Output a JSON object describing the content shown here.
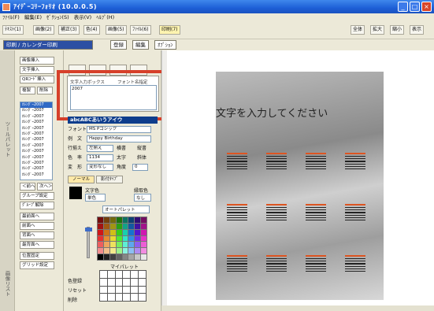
{
  "app": {
    "title": "ｱｲﾃﾞｰｺﾘｰﾌｫﾘｵ (10.0.0.5)"
  },
  "window_controls": [
    "_",
    "□",
    "×"
  ],
  "menu": [
    "ﾌｧｲﾙ(F)",
    "編集(E)",
    "ｾﾞｸｼｮﾝ(S)",
    "表示(V)",
    "ﾍﾙﾌﾟ(H)"
  ],
  "toolbar": {
    "buttons": [
      "ﾃｷｽﾄ(1)",
      "画像(2)",
      "補正(3)",
      "色(4)",
      "画像(5)",
      "ﾌｧｲﾙ(6)",
      "印刷(7)"
    ],
    "right_buttons": [
      "全体",
      "拡大",
      "縮小",
      "表示"
    ]
  },
  "tabs": {
    "breadcrumb": "印刷 / カレンダー印刷",
    "tab1": "登録",
    "tab2": "編集",
    "tab3": "ｵﾌﾟｼｮﾝ"
  },
  "side_label": "ツールパレット",
  "side_label2": "画像リスト",
  "left_buttons": {
    "image_insert": "画像挿入",
    "text_insert": "文字挿入",
    "qr_insert": "QRｺｰﾄﾞ挿入",
    "copy": "複製",
    "delete": "削除",
    "group_set": "グループ設定",
    "group_cancel": "ｸﾞﾙｰﾌﾟ解除",
    "front_most": "最前面へ",
    "front": "前面へ",
    "back": "背面へ",
    "back_most": "最背面へ",
    "lock": "位置固定",
    "grid": "グリッド設定",
    "prev": "＜前へ",
    "next": "次へ＞"
  },
  "list_items": [
    "ｶﾚﾝﾀﾞｰ2007",
    "ｶﾚﾝﾀﾞｰ2007",
    "ｶﾚﾝﾀﾞｰ2007",
    "ｶﾚﾝﾀﾞｰ2007",
    "ｶﾚﾝﾀﾞｰ2007",
    "ｶﾚﾝﾀﾞｰ2007",
    "ｶﾚﾝﾀﾞｰ2007",
    "ｶﾚﾝﾀﾞｰ2007",
    "ｶﾚﾝﾀﾞｰ2007",
    "ｶﾚﾝﾀﾞｰ2007",
    "ｶﾚﾝﾀﾞｰ2007",
    "ｶﾚﾝﾀﾞｰ2007",
    "ｶﾚﾝﾀﾞｰ2007"
  ],
  "text_box": {
    "label": "文字入力ボックス",
    "checkbox": "フォント名指定",
    "value": "2007"
  },
  "banner": "abcABCあいうアイウ",
  "props": {
    "font": {
      "key": "フォント",
      "value": "MS Pゴシック"
    },
    "sample": {
      "key": "例　文",
      "value": "Happy Birthday"
    },
    "align": {
      "key": "行揃え",
      "value": "左揃え",
      "opt1": "横書",
      "opt2": "縦書"
    },
    "color": {
      "key": "色　率",
      "value": "1134",
      "opt1": "太字",
      "opt2": "斜体"
    },
    "shape": {
      "key": "変　形",
      "value": "変形なし",
      "angle_label": "角度",
      "angle": "0"
    }
  },
  "subtabs": [
    "ノーマル",
    "影付ﾀｲﾌﾟ"
  ],
  "color_section": {
    "text_color_label": "文字色",
    "frame_color_label": "縁取色",
    "mode": "単色",
    "frame_mode": "なし",
    "palette_mode": "オートパレット"
  },
  "my_palette": "マイパレット",
  "bottom_actions": [
    "色登録",
    "リセット",
    "削除"
  ],
  "canvas": {
    "placeholder": "文字を入力してください"
  }
}
